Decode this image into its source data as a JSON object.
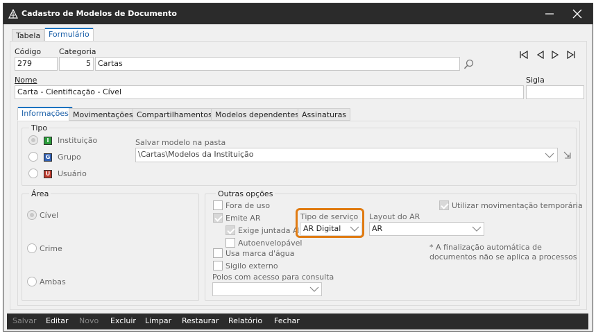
{
  "window": {
    "title": "Cadastro de Modelos de Documento",
    "minimize_symbol": "—",
    "close_symbol": "✕"
  },
  "main_tabs": [
    {
      "label": "Tabela",
      "active": false
    },
    {
      "label": "Formulário",
      "active": true
    }
  ],
  "form": {
    "codigo_label": "Código",
    "codigo_value": "279",
    "categoria_label": "Categoria",
    "categoria_code": "5",
    "categoria_name": "Cartas",
    "nome_label": "Nome",
    "nome_value": "Carta - Cientificação - Cível",
    "sigla_label": "Sigla",
    "sigla_value": ""
  },
  "sub_tabs": [
    {
      "label": "Informações",
      "active": true
    },
    {
      "label": "Movimentações",
      "active": false
    },
    {
      "label": "Compartilhamentos",
      "active": false
    },
    {
      "label": "Modelos dependentes",
      "active": false
    },
    {
      "label": "Assinaturas",
      "active": false
    }
  ],
  "tipo": {
    "title": "Tipo",
    "options": [
      {
        "label": "Instituição",
        "badge": "I",
        "badge_color": "#2a9d3a",
        "selected": true
      },
      {
        "label": "Grupo",
        "badge": "G",
        "badge_color": "#2f5fb3",
        "selected": false
      },
      {
        "label": "Usuário",
        "badge": "U",
        "badge_color": "#c0392b",
        "selected": false
      }
    ],
    "pasta_label": "Salvar modelo na pasta",
    "pasta_value": "\\Cartas\\Modelos da Instituição"
  },
  "area": {
    "title": "Área",
    "options": [
      {
        "label": "Cível",
        "selected": true
      },
      {
        "label": "Crime",
        "selected": false
      },
      {
        "label": "Ambas",
        "selected": false
      }
    ]
  },
  "outras": {
    "title": "Outras opções",
    "fora_de_uso": "Fora de uso",
    "emite_ar": "Emite AR",
    "exige_juntada": "Exige juntada AR",
    "autoenvelopavel": "Autoenvelopável",
    "marca_dagua": "Usa marca d'água",
    "sigilo_externo": "Sigilo externo",
    "polos_label": "Polos com acesso para consulta",
    "polos_value": "",
    "tipo_servico_label": "Tipo de serviço",
    "tipo_servico_value": "AR Digital",
    "layout_ar_label": "Layout do AR",
    "layout_ar_value": "AR",
    "utilizar_mov": "Utilizar movimentação temporária",
    "note_line1": "* A finalização automática de",
    "note_line2": "documentos não se aplica a processos"
  },
  "colors": {
    "highlight": "#e07b12",
    "titlebar": "#2b2b2b",
    "accent": "#1a73c0"
  },
  "footer": [
    {
      "label": "Salvar",
      "enabled": false
    },
    {
      "label": "Editar",
      "enabled": true
    },
    {
      "label": "Novo",
      "enabled": false
    },
    {
      "label": "Excluir",
      "enabled": true
    },
    {
      "label": "Limpar",
      "enabled": true
    },
    {
      "label": "Restaurar",
      "enabled": true
    },
    {
      "label": "Relatório",
      "enabled": true
    },
    {
      "label": "Fechar",
      "enabled": true
    }
  ]
}
